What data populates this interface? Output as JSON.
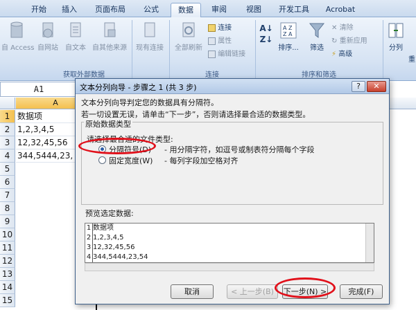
{
  "ribbon": {
    "tabs": [
      "开始",
      "插入",
      "页面布局",
      "公式",
      "数据",
      "审阅",
      "视图",
      "开发工具",
      "Acrobat"
    ],
    "active_tab": "数据",
    "groups": {
      "external": {
        "caption": "获取外部数据",
        "access": "自 Access",
        "web": "自网站",
        "text": "自文本",
        "other": "自其他来源",
        "existing": "现有连接"
      },
      "connections": {
        "caption": "连接",
        "refresh_all": "全部刷新",
        "connections": "连接",
        "properties": "属性",
        "edit_links": "编辑链接"
      },
      "sort_filter": {
        "caption": "排序和筛选",
        "sort": "排序...",
        "filter": "筛选",
        "clear": "清除",
        "reapply": "重新应用",
        "advanced": "高级"
      },
      "tools": {
        "split": "分列",
        "extra": "重"
      }
    }
  },
  "namebox": "A1",
  "sheet": {
    "col_a": "A",
    "rows": [
      "1",
      "2",
      "3",
      "4",
      "5",
      "6",
      "7",
      "8",
      "9",
      "10",
      "11",
      "12",
      "13",
      "14",
      "15"
    ],
    "cells": [
      "数据项",
      "1,2,3,4,5",
      "12,32,45,56",
      "344,5444,23,"
    ]
  },
  "dialog": {
    "title": "文本分列向导 - 步骤之 1 (共 3 步)",
    "help": "?",
    "close": "✕",
    "line1": "文本分列向导判定您的数据具有分隔符。",
    "line2": "若一切设置无误，请单击“下一步”，否则请选择最合适的数据类型。",
    "group_label": "原始数据类型",
    "prompt": "请选择最合适的文件类型:",
    "option_delimited": "分隔符号(D)",
    "option_delimited_desc": "- 用分隔字符，如逗号或制表符分隔每个字段",
    "option_fixed": "固定宽度(W)",
    "option_fixed_desc": "- 每列字段加空格对齐",
    "preview_label": "预览选定数据:",
    "preview_rows": [
      {
        "num": "1",
        "text": "数据项"
      },
      {
        "num": "2",
        "text": "1,2,3,4,5"
      },
      {
        "num": "3",
        "text": "12,32,45,56"
      },
      {
        "num": "4",
        "text": "344,5444,23,54"
      }
    ],
    "buttons": {
      "cancel": "取消",
      "back": "< 上一步(B)",
      "next": "下一步(N) >",
      "finish": "完成(F)"
    }
  }
}
